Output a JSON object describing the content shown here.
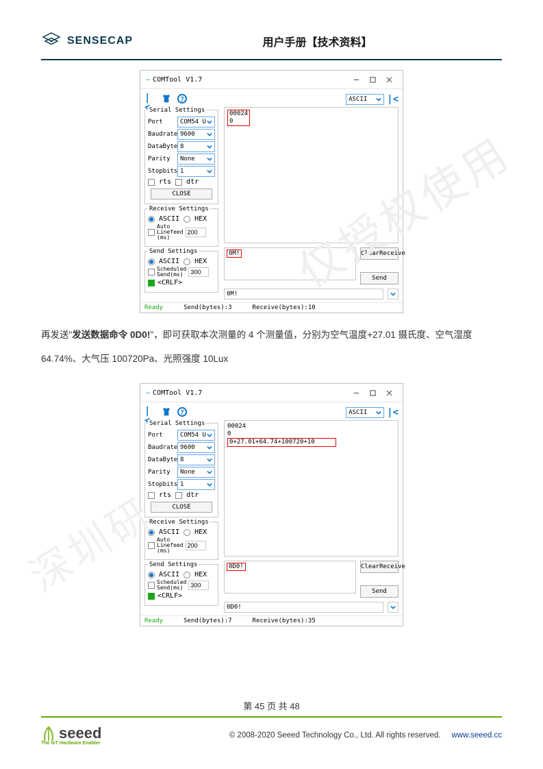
{
  "header": {
    "brand": "SENSECAP",
    "title": "用户手册【技术资料】"
  },
  "watermark1": "仅授权使用",
  "watermark2": "深圳研·",
  "paragraph": {
    "prefix": "再发送\"",
    "bold": "发送数据命令 0D0!",
    "rest": "\"，即可获取本次测量的 4 个测量值，分别为空气温度+27.01 摄氏度、空气湿度64.74%、大气压 100720Pa、光照强度 10Lux"
  },
  "comtool": {
    "title": "COMTool V1.7",
    "topSelect": "ASCII",
    "serial": {
      "legend": "Serial Settings",
      "portLabel": "Port",
      "port": "COM54 U",
      "baudLabel": "Baudrate",
      "baud": "9600",
      "dataLabel": "DataBytes",
      "data": "8",
      "parityLabel": "Parity",
      "parity": "None",
      "stopLabel": "Stopbits",
      "stop": "1",
      "rts": "rts",
      "dtr": "dtr",
      "close": "CLOSE"
    },
    "receive": {
      "legend": "Receive Settings",
      "ascii": "ASCII",
      "hex": "HEX",
      "lfLabel1": "Auto",
      "lfLabel2": "Linefeed",
      "lfLabel3": "(ms)"
    },
    "send": {
      "legend": "Send Settings",
      "ascii": "ASCII",
      "hex": "HEX",
      "schLabel1": "Scheduled",
      "schLabel2": "Send(ms)",
      "schVal": "300",
      "crlf": "<CRLF>"
    },
    "buttons": {
      "clear": "ClearReceive",
      "send": "Send"
    },
    "status": {
      "ready": "Ready"
    }
  },
  "win1": {
    "rx1": "00024",
    "rx2": "0",
    "txBox": "0M!",
    "sendLine": "0M!",
    "lf": "200",
    "statusSend": "Send(bytes):3",
    "statusRecv": "Receive(bytes):10"
  },
  "win2": {
    "rx1": "00024",
    "rx2": "0",
    "rx3": "0+27.01+64.74+100720+10",
    "txBox": "0D0!",
    "sendLine": "0D0!",
    "lf": "200",
    "statusSend": "Send(bytes):7",
    "statusRecv": "Receive(bytes):35"
  },
  "footer": {
    "page": "第 45 页 共 48",
    "brand": "seeed",
    "tagline": "The IoT Hardware Enabler",
    "copyright": "© 2008-2020 Seeed Technology Co., Ltd.   All rights reserved.",
    "link": "www.seeed.cc"
  }
}
